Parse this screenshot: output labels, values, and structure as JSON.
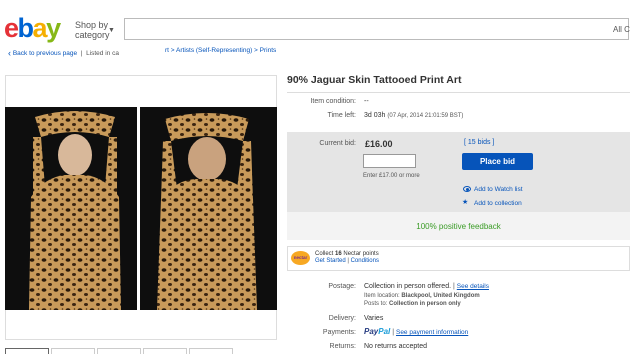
{
  "header": {
    "logo_text": "ebay",
    "shop_by_line1": "Shop by",
    "shop_by_line2": "category",
    "search_category": "All C"
  },
  "breadcrumb": {
    "back_label": "Back to previous page",
    "listed_in": "Listed in ca",
    "path": "rt > Artists (Self-Representing) > Prints"
  },
  "item": {
    "title": "90% Jaguar Skin Tattooed Print Art",
    "condition_label": "Item condition:",
    "condition_value": "--",
    "time_left_label": "Time left:",
    "time_left_value": "3d 03h",
    "time_left_date": "(07 Apr, 2014  21:01:59 BST)"
  },
  "bid": {
    "current_bid_label": "Current bid:",
    "price": "£16.00",
    "bids": "[ 15 bids ]",
    "input_value": "",
    "enter_hint": "Enter £17.00 or more",
    "place_bid_label": "Place bid",
    "watch_list_label": "Add to Watch list",
    "collection_label": "Add to collection",
    "feedback": "100% positive feedback"
  },
  "nectar": {
    "logo_text": "nectar",
    "collect_prefix": "Collect ",
    "points": "16",
    "collect_suffix": " Nectar points",
    "get_started": "Get Started",
    "separator": "|",
    "conditions": "Conditions"
  },
  "shipping": {
    "postage_label": "Postage:",
    "postage_value": "Collection in person offered.",
    "postage_sep": "|",
    "see_details": "See details",
    "location_label": "Item location:",
    "location_value": "Blackpool, United Kingdom",
    "posts_to_label": "Posts to:",
    "posts_to_value": "Collection in person only",
    "delivery_label": "Delivery:",
    "delivery_value": "Varies",
    "payments_label": "Payments:",
    "paypal_part1": "Pay",
    "paypal_part2": "Pal",
    "payments_sep": "|",
    "see_payment": "See payment information",
    "returns_label": "Returns:",
    "returns_value": "No returns accepted"
  },
  "colors": {
    "brand_red": "#e53238",
    "brand_blue": "#0064d2",
    "brand_yellow": "#f5af02",
    "brand_green": "#86b817",
    "link_blue": "#0654ba",
    "feedback_green": "#3b9c27"
  }
}
